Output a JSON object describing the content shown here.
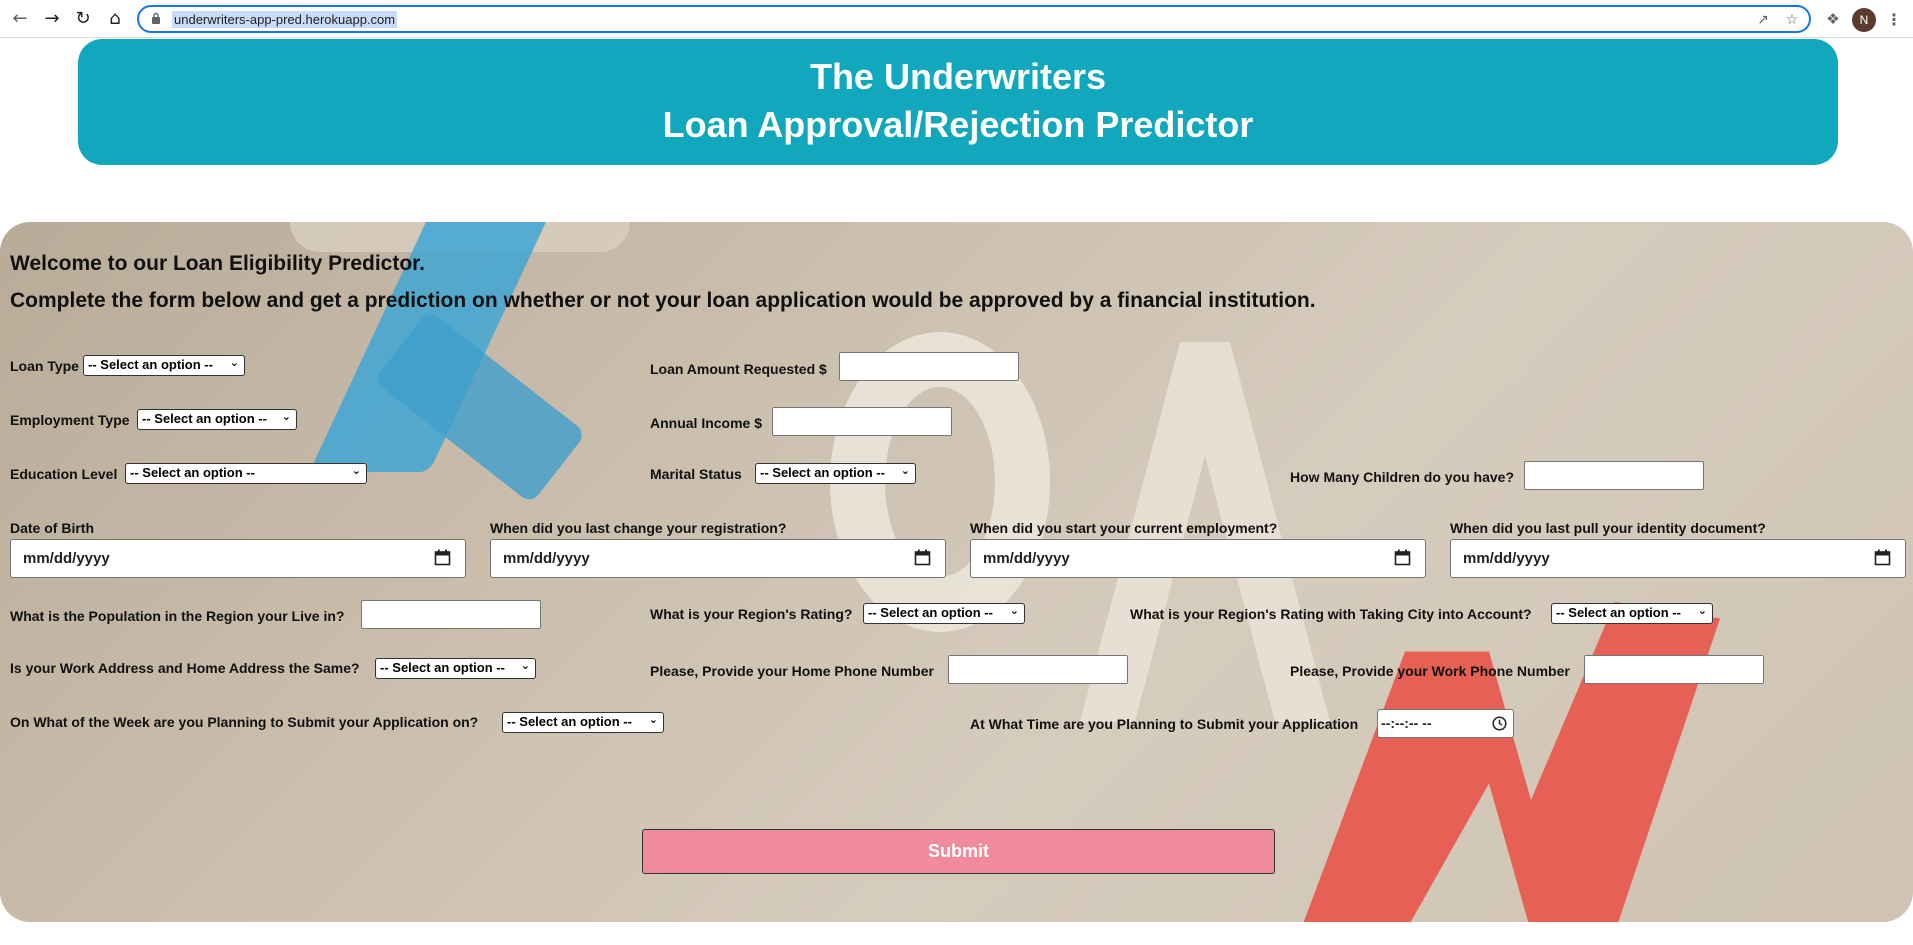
{
  "browser": {
    "url": "underwriters-app-pred.herokuapp.com",
    "avatar_letter": "N"
  },
  "header": {
    "line1": "The Underwriters",
    "line2": "Loan Approval/Rejection Predictor",
    "background": "#11a8bd"
  },
  "intro": {
    "welcome": "Welcome to our Loan Eligibility Predictor.",
    "instructions": "Complete the form below and get a prediction on whether or not your loan application would be approved by a financial institution."
  },
  "form": {
    "select_placeholder": "-- Select an option --",
    "date_placeholder": "mm/dd/yyyy",
    "time_placeholder": "--:--:-- --",
    "loan_type_label": "Loan Type",
    "loan_amount_label": "Loan Amount Requested $",
    "employment_type_label": "Employment Type",
    "annual_income_label": "Annual Income $",
    "education_level_label": "Education Level",
    "marital_status_label": "Marital Status",
    "children_label": "How Many Children do you have?",
    "dob_label": "Date of Birth",
    "registration_label": "When did you last change your registration?",
    "employment_start_label": "When did you start your current employment?",
    "identity_label": "When did you last pull your identity document?",
    "population_label": "What is the Population in the Region your Live in?",
    "region_rating_label": "What is your Region's Rating?",
    "region_city_rating_label": "What is your Region's Rating with Taking City into Account?",
    "same_address_label": "Is your Work Address and Home Address the Same?",
    "home_phone_label": "Please, Provide your Home Phone Number",
    "work_phone_label": "Please, Provide your Work Phone Number",
    "weekday_label": "On What of the Week are you Planning to Submit your Application on?",
    "time_label": "At What Time are you Planning to Submit your Application",
    "submit_label": "Submit",
    "submit_color": "#ef8b9c"
  }
}
